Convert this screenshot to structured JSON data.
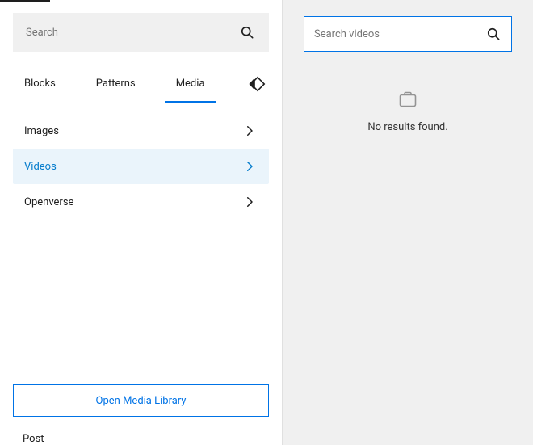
{
  "left": {
    "searchPlaceholder": "Search",
    "tabs": [
      {
        "label": "Blocks",
        "active": false
      },
      {
        "label": "Patterns",
        "active": false
      },
      {
        "label": "Media",
        "active": true
      }
    ],
    "mediaCategories": [
      {
        "label": "Images",
        "active": false
      },
      {
        "label": "Videos",
        "active": true
      },
      {
        "label": "Openverse",
        "active": false
      }
    ],
    "openLibraryLabel": "Open Media Library",
    "postLabel": "Post"
  },
  "right": {
    "searchPlaceholder": "Search videos",
    "emptyMessage": "No results found."
  },
  "icons": {
    "search": "search-icon",
    "collapse": "collapse-icon",
    "chevronRight": "chevron-right-icon",
    "mediaEmpty": "media-empty-icon"
  }
}
